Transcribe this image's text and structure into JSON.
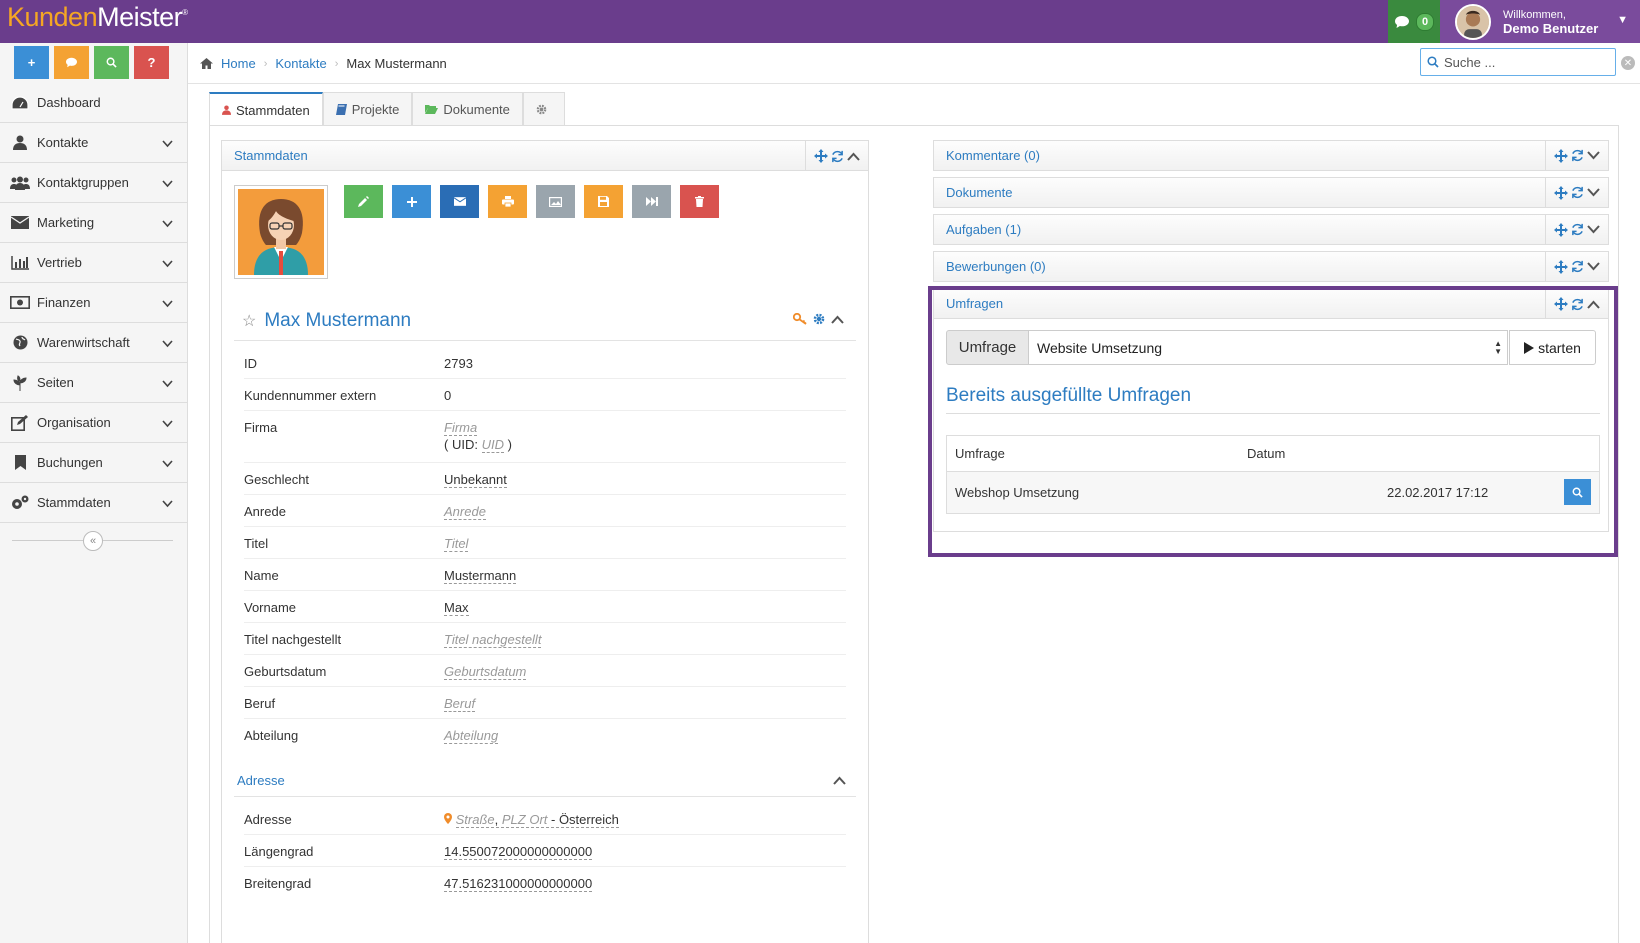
{
  "app": {
    "logo_part1": "Kunden",
    "logo_part2": "Meister",
    "logo_mark": "®"
  },
  "topbar": {
    "messages_count": "0",
    "welcome": "Willkommen,",
    "user_name": "Demo Benutzer"
  },
  "quick_buttons": [
    {
      "icon": "plus-icon",
      "label": "+"
    },
    {
      "icon": "chat-icon",
      "label": ""
    },
    {
      "icon": "search-icon",
      "label": ""
    },
    {
      "icon": "help-icon",
      "label": "?"
    }
  ],
  "sidebar": {
    "items": [
      {
        "label": "Dashboard",
        "icon": "dashboard-icon"
      },
      {
        "label": "Kontakte",
        "icon": "user-icon"
      },
      {
        "label": "Kontaktgruppen",
        "icon": "users-icon"
      },
      {
        "label": "Marketing",
        "icon": "envelope-icon"
      },
      {
        "label": "Vertrieb",
        "icon": "bar-chart-icon"
      },
      {
        "label": "Finanzen",
        "icon": "money-icon"
      },
      {
        "label": "Warenwirtschaft",
        "icon": "globe-icon"
      },
      {
        "label": "Seiten",
        "icon": "tree-icon"
      },
      {
        "label": "Organisation",
        "icon": "edit-icon"
      },
      {
        "label": "Buchungen",
        "icon": "bookmark-icon"
      },
      {
        "label": "Stammdaten",
        "icon": "gears-icon"
      }
    ]
  },
  "breadcrumb": {
    "home": "Home",
    "contacts": "Kontakte",
    "current": "Max Mustermann"
  },
  "search": {
    "placeholder": "Suche ..."
  },
  "tabs": [
    {
      "label": "Stammdaten"
    },
    {
      "label": "Projekte"
    },
    {
      "label": "Dokumente"
    },
    {
      "label": ""
    }
  ],
  "left_panel": {
    "title": "Stammdaten",
    "person_name": "Max Mustermann",
    "fields": [
      {
        "label": "ID",
        "value": "2793",
        "type": "plain"
      },
      {
        "label": "Kundennummer extern",
        "value": "0",
        "type": "plain"
      },
      {
        "label": "Firma",
        "value": "Firma",
        "type": "placeholder",
        "uid_prefix": "( UID: ",
        "uid": "UID",
        "uid_suffix": " )"
      },
      {
        "label": "Geschlecht",
        "value": "Unbekannt",
        "type": "editable"
      },
      {
        "label": "Anrede",
        "value": "Anrede",
        "type": "placeholder"
      },
      {
        "label": "Titel",
        "value": "Titel",
        "type": "placeholder"
      },
      {
        "label": "Name",
        "value": "Mustermann",
        "type": "editable"
      },
      {
        "label": "Vorname",
        "value": "Max",
        "type": "editable"
      },
      {
        "label": "Titel nachgestellt",
        "value": "Titel nachgestellt",
        "type": "placeholder"
      },
      {
        "label": "Geburtsdatum",
        "value": "Geburtsdatum",
        "type": "placeholder"
      },
      {
        "label": "Beruf",
        "value": "Beruf",
        "type": "placeholder"
      },
      {
        "label": "Abteilung",
        "value": "Abteilung",
        "type": "placeholder"
      }
    ],
    "address_section": "Adresse",
    "address_fields": [
      {
        "label": "Adresse",
        "street": "Straße",
        "comma": ", ",
        "city": "PLZ Ort",
        "country": " - Österreich"
      },
      {
        "label": "Längengrad",
        "value": "14.550072000000000000"
      },
      {
        "label": "Breitengrad",
        "value": "47.516231000000000000"
      }
    ]
  },
  "right_widgets": [
    {
      "title": "Kommentare (0)"
    },
    {
      "title": "Dokumente"
    },
    {
      "title": "Aufgaben (1)"
    },
    {
      "title": "Bewerbungen (0)"
    }
  ],
  "umfragen": {
    "title": "Umfragen",
    "select_label": "Umfrage",
    "selected": "Website Umsetzung",
    "start_label": "starten",
    "completed_heading": "Bereits ausgefüllte Umfragen",
    "table_headers": {
      "survey": "Umfrage",
      "date": "Datum"
    },
    "rows": [
      {
        "survey": "Webshop Umsetzung",
        "date": "22.02.2017 17:12"
      }
    ]
  },
  "colors": {
    "topbar": "#6a3d8c",
    "accent": "#2d7cc1",
    "highlight": "#6a3d8c"
  }
}
